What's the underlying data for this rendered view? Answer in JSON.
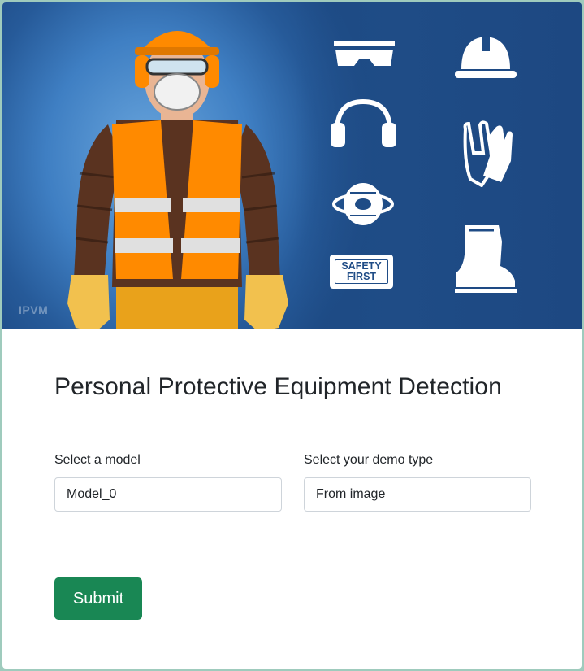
{
  "hero": {
    "watermark": "IPVM",
    "badge_line1": "SAFETY",
    "badge_line2": "FIRST",
    "icons": [
      "safety-goggles-icon",
      "hard-hat-icon",
      "ear-muffs-icon",
      "gloves-icon",
      "face-mask-icon",
      "safety-boot-icon"
    ],
    "colors": {
      "background": "#1f4c86",
      "vest": "#ff8a00",
      "helmet": "#ff8a00"
    }
  },
  "form": {
    "title": "Personal Protective Equipment Detection",
    "model_label": "Select a model",
    "model_value": "Model_0",
    "demo_label": "Select your demo type",
    "demo_value": "From image",
    "submit_label": "Submit"
  },
  "colors": {
    "submit": "#198754",
    "page_border": "#9fcbbd"
  }
}
